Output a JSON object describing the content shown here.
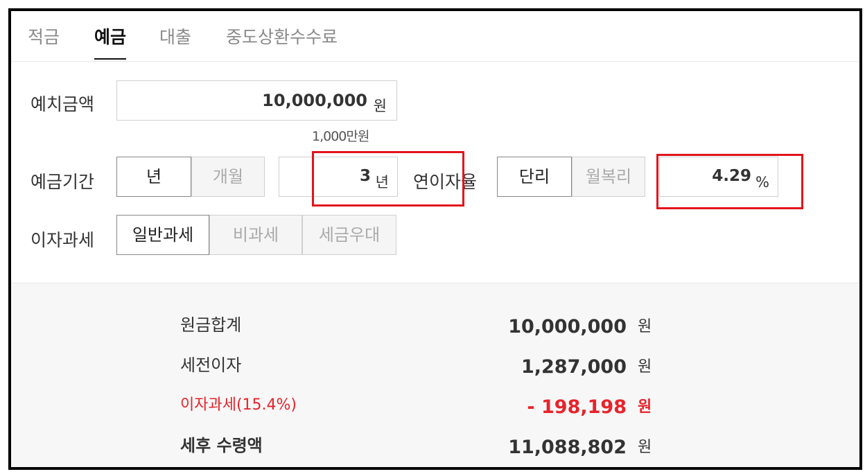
{
  "tabs": [
    "적금",
    "예금",
    "대출",
    "중도상환수수료"
  ],
  "active_tab": "예금",
  "deposit": {
    "label": "예치금액",
    "value": "10,000,000",
    "unit": "원",
    "hint": "1,000만원"
  },
  "period": {
    "label": "예금기간",
    "options": [
      "년",
      "개월"
    ],
    "selected": "년",
    "value": "3",
    "unit": "년"
  },
  "rate": {
    "label": "연이자율",
    "options": [
      "단리",
      "월복리"
    ],
    "selected": "단리",
    "value": "4.29",
    "unit": "%"
  },
  "tax": {
    "label": "이자과세",
    "options": [
      "일반과세",
      "비과세",
      "세금우대"
    ],
    "selected": "일반과세"
  },
  "results": [
    {
      "label": "원금합계",
      "value": "10,000,000",
      "unit": "원"
    },
    {
      "label": "세전이자",
      "value": "1,287,000",
      "unit": "원"
    },
    {
      "label": "이자과세(15.4%)",
      "value": "- 198,198",
      "unit": "원"
    },
    {
      "label": "세후 수령액",
      "value": "11,088,802",
      "unit": "원"
    }
  ],
  "colors": {
    "highlight": "#e3131b",
    "tax_text": "#e8232a"
  }
}
